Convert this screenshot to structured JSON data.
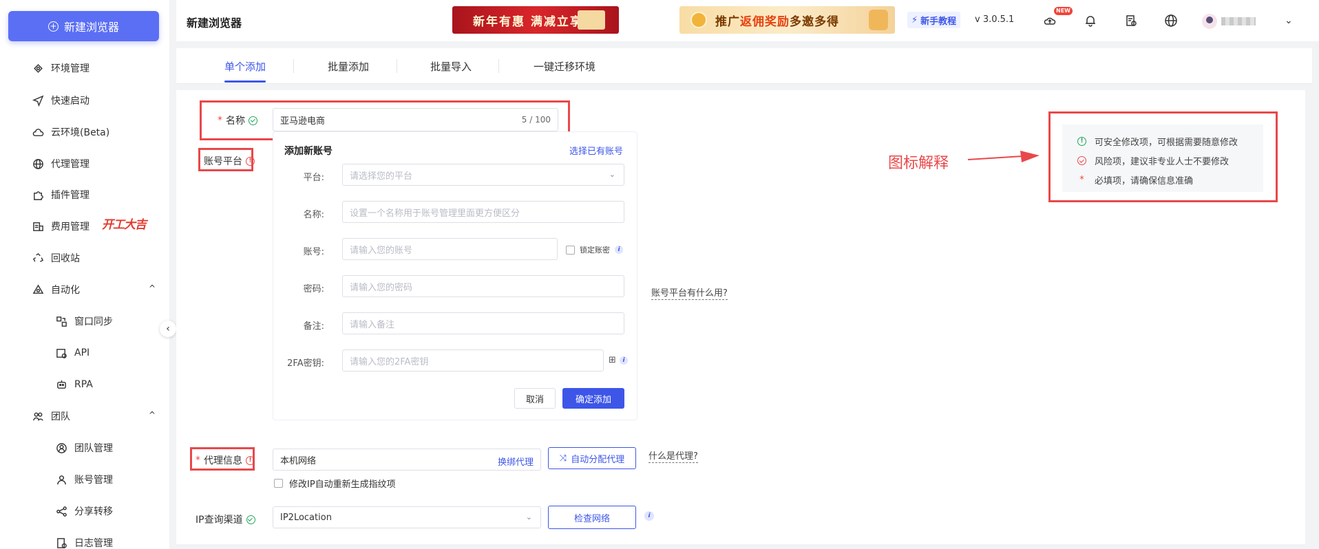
{
  "sidebar": {
    "new_button": "新建浏览器",
    "items": [
      {
        "label": "环境管理",
        "icon": "env-icon"
      },
      {
        "label": "快速启动",
        "icon": "send-icon"
      },
      {
        "label": "云环境(Beta)",
        "icon": "cloud-icon"
      },
      {
        "label": "代理管理",
        "icon": "globe-icon"
      },
      {
        "label": "插件管理",
        "icon": "plugin-icon"
      },
      {
        "label": "费用管理",
        "icon": "billing-icon"
      },
      {
        "label": "回收站",
        "icon": "recycle-icon"
      },
      {
        "label": "自动化",
        "icon": "automation-icon"
      },
      {
        "label": "窗口同步",
        "icon": "window-sync-icon"
      },
      {
        "label": "API",
        "icon": "api-icon"
      },
      {
        "label": "RPA",
        "icon": "robot-icon"
      },
      {
        "label": "团队",
        "icon": "team-icon"
      },
      {
        "label": "团队管理",
        "icon": "team-manage-icon"
      },
      {
        "label": "账号管理",
        "icon": "user-icon"
      },
      {
        "label": "分享转移",
        "icon": "share-icon"
      },
      {
        "label": "日志管理",
        "icon": "log-icon"
      }
    ],
    "promo_tag": "开工大吉"
  },
  "header": {
    "title": "新建浏览器",
    "banner1": "新年有惠 满减立享",
    "banner2_a": "推广",
    "banner2_b": "返佣奖励",
    "banner2_c": " 多邀多得",
    "tutorial": "新手教程",
    "version": "v 3.0.5.1",
    "new_badge": "NEW"
  },
  "tabs": [
    "单个添加",
    "批量添加",
    "批量导入",
    "一键迁移环境"
  ],
  "form": {
    "name_label": "名称",
    "name_value": "亚马逊电商",
    "name_counter": "5 / 100",
    "platform_label": "账号平台",
    "card_title": "添加新账号",
    "card_link": "选择已有账号",
    "platform_field_label": "平台:",
    "platform_placeholder": "请选择您的平台",
    "acct_name_label": "名称:",
    "acct_name_placeholder": "设置一个名称用于账号管理里面更方便区分",
    "account_label": "账号:",
    "account_placeholder": "请输入您的账号",
    "lock_password": "锁定账密",
    "password_label": "密码:",
    "password_placeholder": "请输入您的密码",
    "note_label": "备注:",
    "note_placeholder": "请输入备注",
    "twofa_label": "2FA密钥:",
    "twofa_placeholder": "请输入您的2FA密钥",
    "cancel": "取消",
    "confirm": "确定添加",
    "platform_help": "账号平台有什么用?",
    "proxy_label": "代理信息",
    "proxy_value": "本机网络",
    "proxy_link": "换绑代理",
    "auto_assign": "自动分配代理",
    "proxy_help": "什么是代理?",
    "ip_regen": "修改IP自动重新生成指纹项",
    "ip_channel_label": "IP查询渠道",
    "ip_channel_value": "IP2Location",
    "check_network": "检查网络"
  },
  "legend": {
    "safe": "可安全修改项，可根据需要随意修改",
    "risk": "风险项，建议非专业人士不要修改",
    "required": "必填项，请确保信息准确",
    "annotation": "图标解释"
  },
  "colors": {
    "accent": "#3d56e8",
    "annotation": "#e8484a",
    "ok": "#22a55a"
  }
}
